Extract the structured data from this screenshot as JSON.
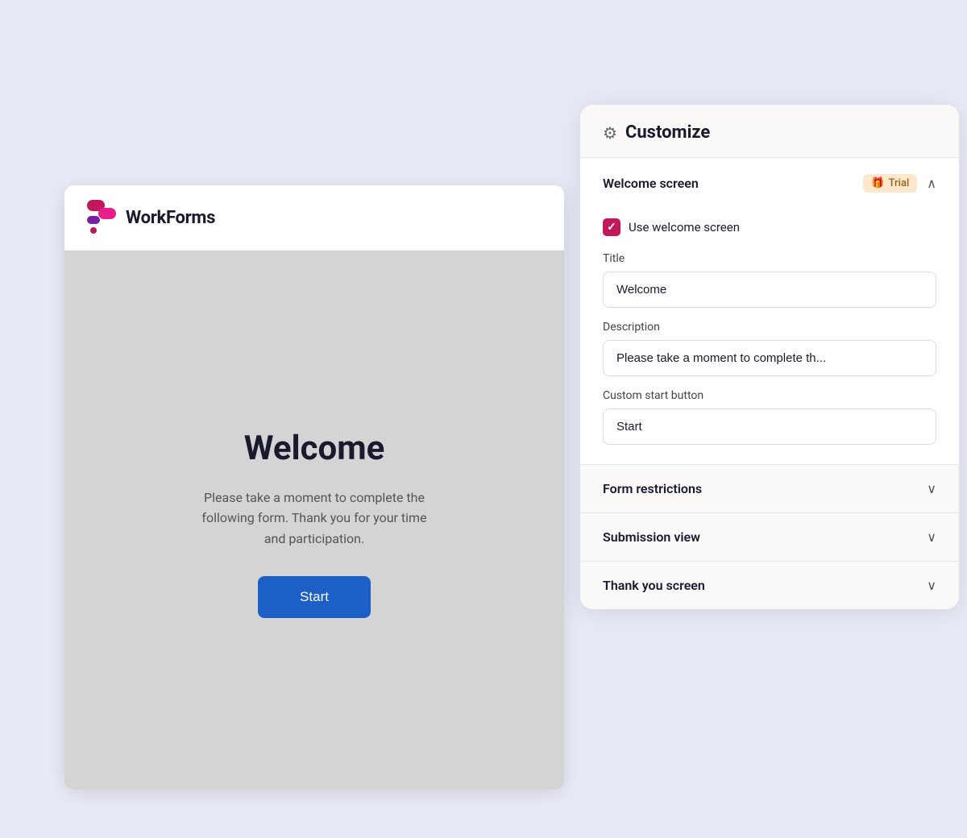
{
  "preview": {
    "logo_text": "WorkForms",
    "welcome_title": "Welcome",
    "description": "Please take a moment to complete the following form. Thank you for your time and participation.",
    "start_button": "Start"
  },
  "customize": {
    "panel_title": "Customize",
    "gear_icon": "⚙",
    "sections": [
      {
        "id": "welcome-screen",
        "title": "Welcome screen",
        "badge": "Trial",
        "badge_icon": "🎁",
        "expanded": true,
        "chevron": "∧",
        "fields": {
          "checkbox_label": "Use welcome screen",
          "checkbox_checked": true,
          "title_label": "Title",
          "title_value": "Welcome",
          "description_label": "Description",
          "description_value": "Please take a moment to complete th...",
          "button_label": "Custom start button",
          "button_value": "Start"
        }
      },
      {
        "id": "form-restrictions",
        "title": "Form restrictions",
        "expanded": false,
        "chevron": "∨"
      },
      {
        "id": "submission-view",
        "title": "Submission view",
        "expanded": false,
        "chevron": "∨"
      },
      {
        "id": "thank-you-screen",
        "title": "Thank you screen",
        "expanded": false,
        "chevron": "∨"
      }
    ]
  }
}
